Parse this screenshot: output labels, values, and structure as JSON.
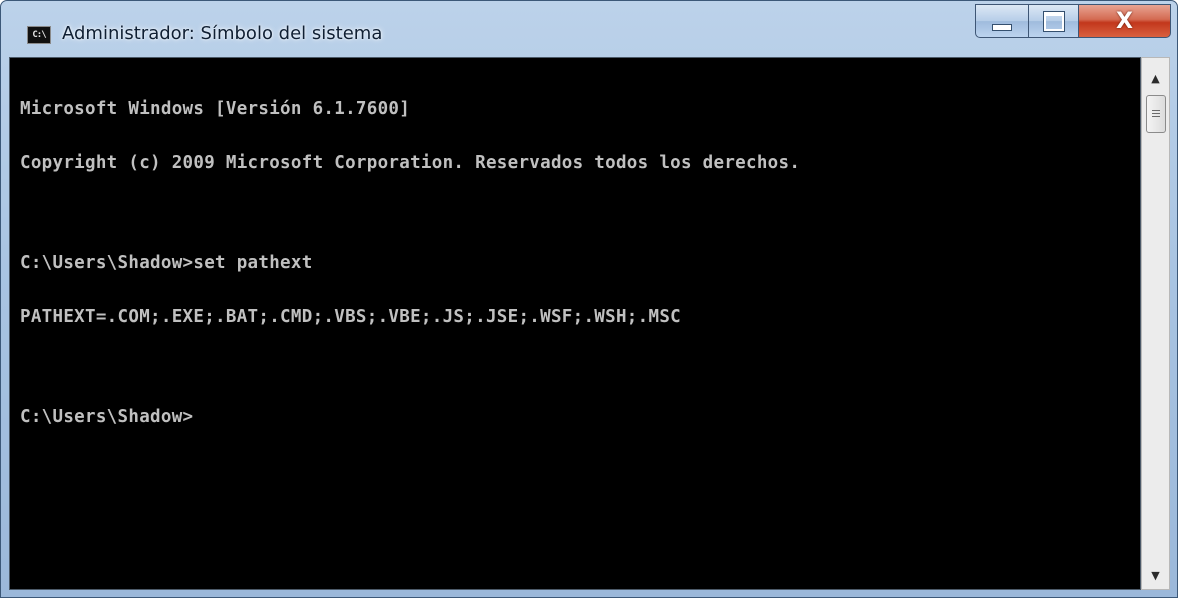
{
  "window": {
    "title": "Administrador: Símbolo del sistema",
    "icon_label": "C:\\",
    "colors": {
      "titlebar": "#a9c4e2",
      "console_bg": "#000000",
      "console_fg": "#c0c0c0",
      "close": "#c2371c"
    },
    "caption_buttons": {
      "minimize": "minimize-icon",
      "maximize": "maximize-icon",
      "close": "close-icon"
    },
    "close_glyph": "X"
  },
  "console": {
    "lines": [
      "Microsoft Windows [Versión 6.1.7600]",
      "Copyright (c) 2009 Microsoft Corporation. Reservados todos los derechos.",
      "",
      "C:\\Users\\Shadow>set pathext",
      "PATHEXT=.COM;.EXE;.BAT;.CMD;.VBS;.VBE;.JS;.JSE;.WSF;.WSH;.MSC",
      "",
      "C:\\Users\\Shadow>"
    ]
  },
  "scrollbar": {
    "up_arrow": "▲",
    "down_arrow": "▼"
  }
}
